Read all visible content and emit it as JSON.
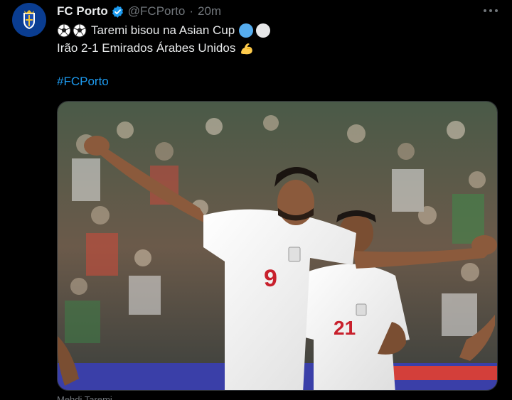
{
  "tweet": {
    "author": {
      "name": "FC Porto",
      "handle": "@FCPorto",
      "verified": true,
      "avatar_icon": "fc-porto-crest-icon"
    },
    "separator": "·",
    "time": "20m",
    "more_icon": "more-horizontal-icon",
    "text_line1": "Taremi bisou na Asian Cup",
    "text_line2": "Irão 2-1 Emirados Árabes Unidos",
    "emoji_line1_leading": [
      "soccer-ball-icon",
      "soccer-ball-icon"
    ],
    "emoji_line1_trailing": [
      "blue-circle-icon",
      "white-circle-icon"
    ],
    "emoji_line2_trailing": "flexed-biceps-icon",
    "hashtag": "#FCPorto",
    "media_caption": "Mehdi Taremi",
    "media_description_icon": "football-celebration-photo"
  },
  "colors": {
    "background": "#000000",
    "text": "#e7e9ea",
    "muted": "#71767b",
    "link": "#1d9bf0",
    "verified": "#1d9bf0",
    "porto_blue": "#0a3d91"
  }
}
